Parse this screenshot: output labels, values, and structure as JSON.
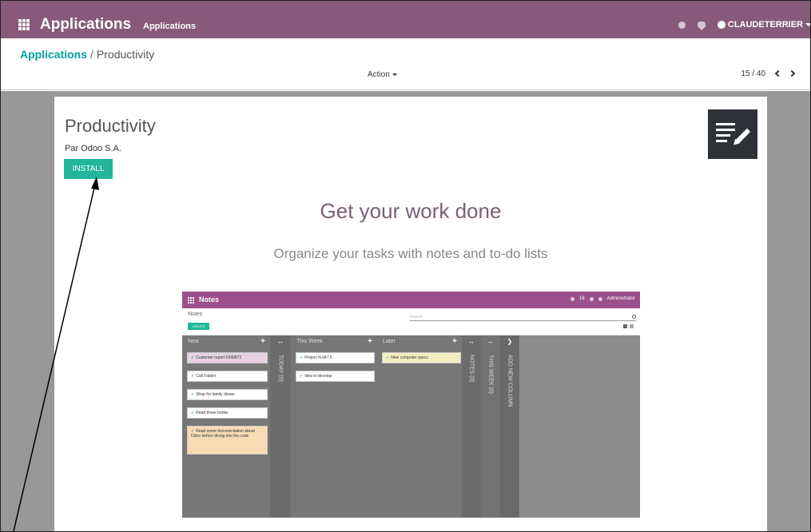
{
  "navbar": {
    "app_name": "Applications",
    "menu_item": "Applications",
    "user_name": "CLAUDETERRIER",
    "icons": [
      "apps-grid-icon",
      "activity-icon",
      "chat-icon",
      "user-avatar",
      "caret-down-icon"
    ]
  },
  "control_panel": {
    "breadcrumb_parent": "Applications",
    "breadcrumb_separator": "/",
    "breadcrumb_current": "Productivity",
    "action_label": "Action",
    "pager": "15 / 40"
  },
  "module": {
    "name": "Productivity",
    "author": "Par Odoo S.A.",
    "install_label": "INSTALL",
    "icon": "notes-pencil-icon",
    "headline": "Get your work done",
    "subheadline": "Organize your tasks with notes and to-do lists"
  },
  "preview": {
    "app_title": "Notes",
    "sys_badge": "18",
    "user": "Administrator",
    "breadcrumb": "Notes",
    "create_label": "CREATE",
    "search_placeholder": "Search...",
    "columns": [
      {
        "name": "New",
        "cards": [
          "Customer report #349872",
          "Call Fabien",
          "Shop for family dinner",
          "Read those books",
          "Read some documentation about Odoo before diving into the code"
        ]
      },
      {
        "name": "TODAY (0)",
        "folded": true
      },
      {
        "name": "This Week",
        "cards": [
          "Project N.947.5",
          "Idea to develop"
        ]
      },
      {
        "name": "Later",
        "cards": [
          "New computer specs"
        ]
      },
      {
        "name": "NOTES (0)",
        "folded": true
      },
      {
        "name": "THIS WEEK (0)",
        "folded": true
      },
      {
        "name": "ADD NEW COLUMN",
        "folded": true
      }
    ]
  },
  "colors": {
    "navbar": "#875a7b",
    "link": "#00a09d",
    "install_button": "#21b799",
    "headline": "#7c5f75",
    "preview_navbar": "#9c4f8b"
  }
}
